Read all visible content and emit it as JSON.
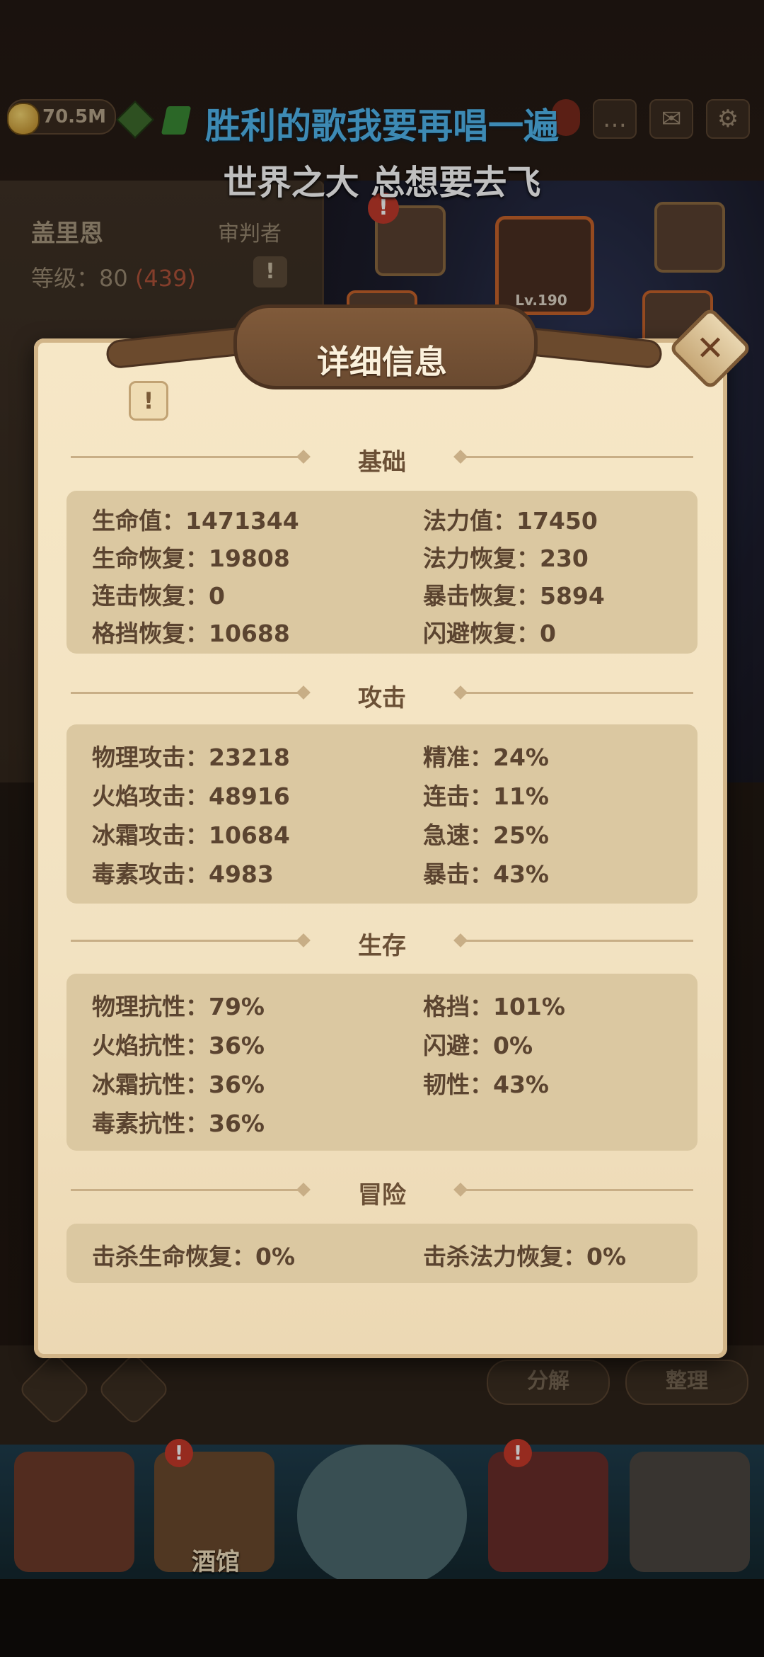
{
  "topbar": {
    "gold": "70.5M",
    "icons": [
      "chat-icon",
      "mail-icon",
      "gear-icon"
    ]
  },
  "lyrics": {
    "line1": "胜利的歌我要再唱一遍",
    "line2": "世界之大 总想要去飞"
  },
  "hero": {
    "name": "盖里恩",
    "class": "审判者",
    "level_label": "等级：80",
    "level_extra": "(439)",
    "warn": "!"
  },
  "equipment": {
    "helm_level": "Lv.190"
  },
  "dialog": {
    "title": "详细信息",
    "close": "✕",
    "info": "!",
    "sections": {
      "basic": {
        "title": "基础",
        "left": [
          "生命值：1471344",
          "生命恢复：19808",
          "连击恢复：0",
          "格挡恢复：10688"
        ],
        "right": [
          "法力值：17450",
          "法力恢复：230",
          "暴击恢复：5894",
          "闪避恢复：0"
        ]
      },
      "attack": {
        "title": "攻击",
        "left": [
          "物理攻击：23218",
          "火焰攻击：48916",
          "冰霜攻击：10684",
          "毒素攻击：4983"
        ],
        "right": [
          "精准：24%",
          "连击：11%",
          "急速：25%",
          "暴击：43%"
        ]
      },
      "survival": {
        "title": "生存",
        "left": [
          "物理抗性：79%",
          "火焰抗性：36%",
          "冰霜抗性：36%",
          "毒素抗性：36%"
        ],
        "right": [
          "格挡：101%",
          "闪避：0%",
          "韧性：43%"
        ]
      },
      "adventure": {
        "title": "冒险",
        "left": [
          "击杀生命恢复：0%"
        ],
        "right": [
          "击杀法力恢复：0%"
        ]
      }
    }
  },
  "bottom_buttons": {
    "decompose": "分解",
    "sort": "整理"
  },
  "navbar": {
    "tavern": "酒馆",
    "warn": "!"
  }
}
